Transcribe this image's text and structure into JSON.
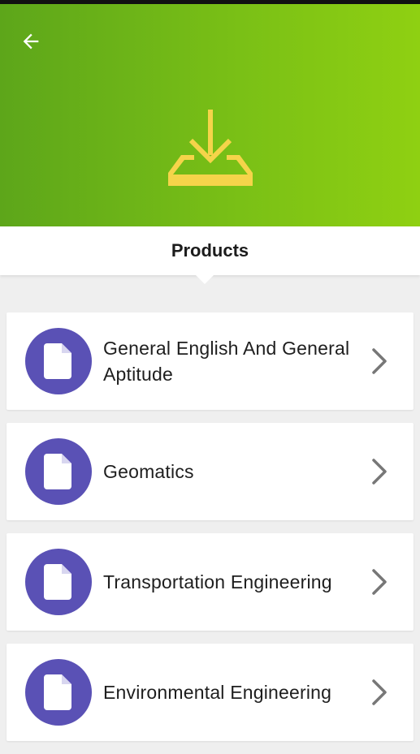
{
  "header": {
    "back_icon": "arrow-left-icon",
    "hero_icon": "download-tray-icon",
    "colors": {
      "gradient_start": "#5da61a",
      "gradient_end": "#8fd012",
      "icon_yellow": "#f5d44a"
    }
  },
  "tabs": {
    "active_label": "Products"
  },
  "products": [
    {
      "title": "General English And General Aptitude",
      "icon": "document-icon"
    },
    {
      "title": "Geomatics",
      "icon": "document-icon"
    },
    {
      "title": "Transportation Engineering",
      "icon": "document-icon"
    },
    {
      "title": "Environmental Engineering",
      "icon": "document-icon"
    }
  ],
  "colors": {
    "avatar": "#5a51b5",
    "chevron": "#777777"
  }
}
